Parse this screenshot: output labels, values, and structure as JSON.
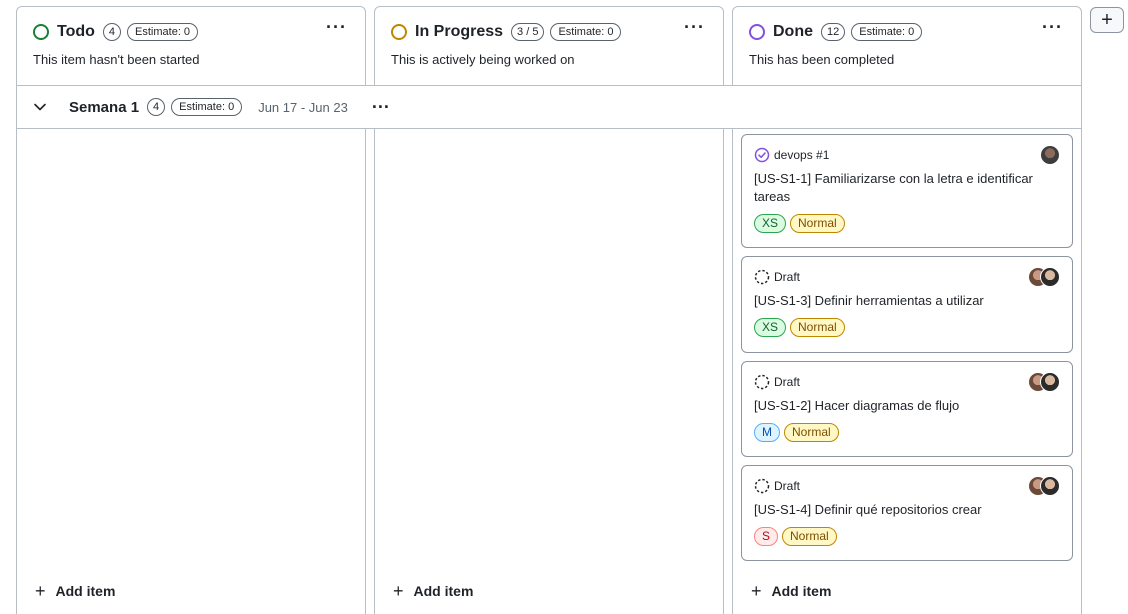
{
  "columns": [
    {
      "name": "Todo",
      "count": "4",
      "estimate": "Estimate: 0",
      "description": "This item hasn't been started",
      "color": "#1a7f37",
      "menu": "···",
      "add_label": "Add item"
    },
    {
      "name": "In Progress",
      "count": "3 / 5",
      "estimate": "Estimate: 0",
      "description": "This is actively being worked on",
      "color": "#bf8700",
      "menu": "···",
      "add_label": "Add item"
    },
    {
      "name": "Done",
      "count": "12",
      "estimate": "Estimate: 0",
      "description": "This has been completed",
      "color": "#8250df",
      "menu": "···",
      "add_label": "Add item"
    }
  ],
  "group": {
    "name": "Semana 1",
    "count": "4",
    "estimate": "Estimate: 0",
    "dates": "Jun 17 - Jun 23",
    "menu": "···"
  },
  "add_column": {
    "label": "+"
  },
  "cards": [
    {
      "meta": "devops #1",
      "type_icon": "closed-issue-icon",
      "title": "[US-S1-1] Familiarizarse con la letra e identificar tareas",
      "size": "XS",
      "priority": "Normal"
    },
    {
      "meta": "Draft",
      "type_icon": "draft-icon",
      "title": "[US-S1-3] Definir herramientas a utilizar",
      "size": "XS",
      "priority": "Normal"
    },
    {
      "meta": "Draft",
      "type_icon": "draft-icon",
      "title": "[US-S1-2] Hacer diagramas de flujo",
      "size": "M",
      "priority": "Normal"
    },
    {
      "meta": "Draft",
      "type_icon": "draft-icon",
      "title": "[US-S1-4] Definir qué repositorios crear",
      "size": "S",
      "priority": "Normal"
    }
  ]
}
